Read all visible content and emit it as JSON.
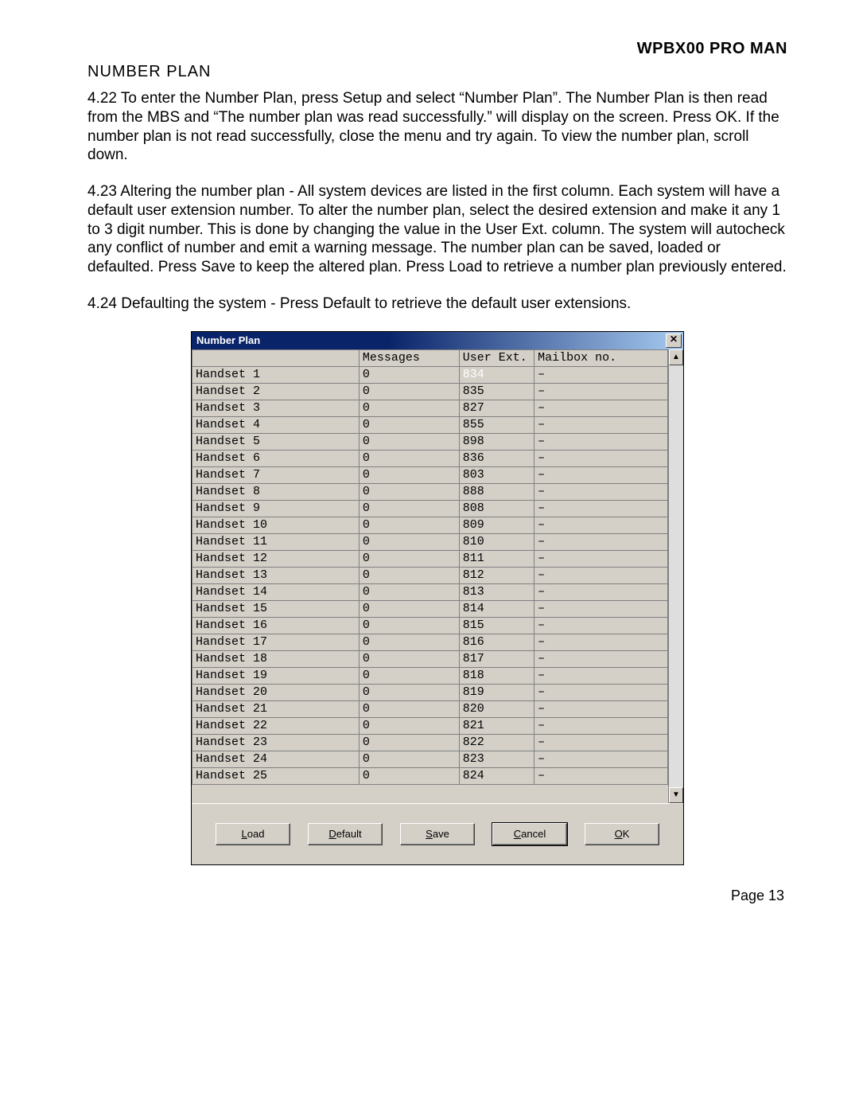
{
  "header": {
    "title": "WPBX00 PRO MAN"
  },
  "section_heading": "NUMBER PLAN",
  "para_422": "4.22    To enter the Number Plan, press Setup and select “Number Plan”.\nThe Number Plan is then read from the MBS and “The number plan was read successfully.” will display on the screen.  Press OK.  If the number plan is not read successfully, close the menu and try again.  To view the number plan, scroll down.",
  "para_423": "4.23    Altering the number plan - All system devices are listed in the first column.  Each system will have a default user extension number.  To alter the number plan, select the desired extension and make it any 1 to 3 digit number.  This is done by  changing the value in the User Ext. column.  The system will autocheck any conflict of number and emit a warning message.  The number plan can be saved, loaded or defaulted. Press Save to keep the altered plan.  Press Load to retrieve a number plan previously entered.",
  "para_424": "4.24    Defaulting the system - Press Default to retrieve the default user extensions.",
  "footer": "Page 13",
  "dialog": {
    "title": "Number Plan",
    "columns": {
      "device": "",
      "messages": "Messages",
      "user_ext": "User Ext.",
      "mailbox": "Mailbox no."
    },
    "rows": [
      {
        "device": "Handset 1",
        "messages": "0",
        "user_ext": "834",
        "mailbox": "–",
        "selected": true
      },
      {
        "device": "Handset 2",
        "messages": "0",
        "user_ext": "835",
        "mailbox": "–"
      },
      {
        "device": "Handset 3",
        "messages": "0",
        "user_ext": "827",
        "mailbox": "–"
      },
      {
        "device": "Handset 4",
        "messages": "0",
        "user_ext": "855",
        "mailbox": "–"
      },
      {
        "device": "Handset 5",
        "messages": "0",
        "user_ext": "898",
        "mailbox": "–"
      },
      {
        "device": "Handset 6",
        "messages": "0",
        "user_ext": "836",
        "mailbox": "–"
      },
      {
        "device": "Handset 7",
        "messages": "0",
        "user_ext": "803",
        "mailbox": "–"
      },
      {
        "device": "Handset 8",
        "messages": "0",
        "user_ext": "888",
        "mailbox": "–"
      },
      {
        "device": "Handset 9",
        "messages": "0",
        "user_ext": "808",
        "mailbox": "–"
      },
      {
        "device": "Handset 10",
        "messages": "0",
        "user_ext": "809",
        "mailbox": "–"
      },
      {
        "device": "Handset 11",
        "messages": "0",
        "user_ext": "810",
        "mailbox": "–"
      },
      {
        "device": "Handset 12",
        "messages": "0",
        "user_ext": "811",
        "mailbox": "–"
      },
      {
        "device": "Handset 13",
        "messages": "0",
        "user_ext": "812",
        "mailbox": "–"
      },
      {
        "device": "Handset 14",
        "messages": "0",
        "user_ext": "813",
        "mailbox": "–"
      },
      {
        "device": "Handset 15",
        "messages": "0",
        "user_ext": "814",
        "mailbox": "–"
      },
      {
        "device": "Handset 16",
        "messages": "0",
        "user_ext": "815",
        "mailbox": "–"
      },
      {
        "device": "Handset 17",
        "messages": "0",
        "user_ext": "816",
        "mailbox": "–"
      },
      {
        "device": "Handset 18",
        "messages": "0",
        "user_ext": "817",
        "mailbox": "–"
      },
      {
        "device": "Handset 19",
        "messages": "0",
        "user_ext": "818",
        "mailbox": "–"
      },
      {
        "device": "Handset 20",
        "messages": "0",
        "user_ext": "819",
        "mailbox": "–"
      },
      {
        "device": "Handset 21",
        "messages": "0",
        "user_ext": "820",
        "mailbox": "–"
      },
      {
        "device": "Handset 22",
        "messages": "0",
        "user_ext": "821",
        "mailbox": "–"
      },
      {
        "device": "Handset 23",
        "messages": "0",
        "user_ext": "822",
        "mailbox": "–"
      },
      {
        "device": "Handset 24",
        "messages": "0",
        "user_ext": "823",
        "mailbox": "–"
      },
      {
        "device": "Handset 25",
        "messages": "0",
        "user_ext": "824",
        "mailbox": "–"
      }
    ],
    "buttons": {
      "load": {
        "prefix": "L",
        "rest": "oad"
      },
      "default": {
        "prefix": "D",
        "rest": "efault"
      },
      "save": {
        "prefix": "S",
        "rest": "ave"
      },
      "cancel": {
        "prefix": "C",
        "rest": "ancel"
      },
      "ok": {
        "prefix": "O",
        "rest": "K"
      }
    }
  }
}
